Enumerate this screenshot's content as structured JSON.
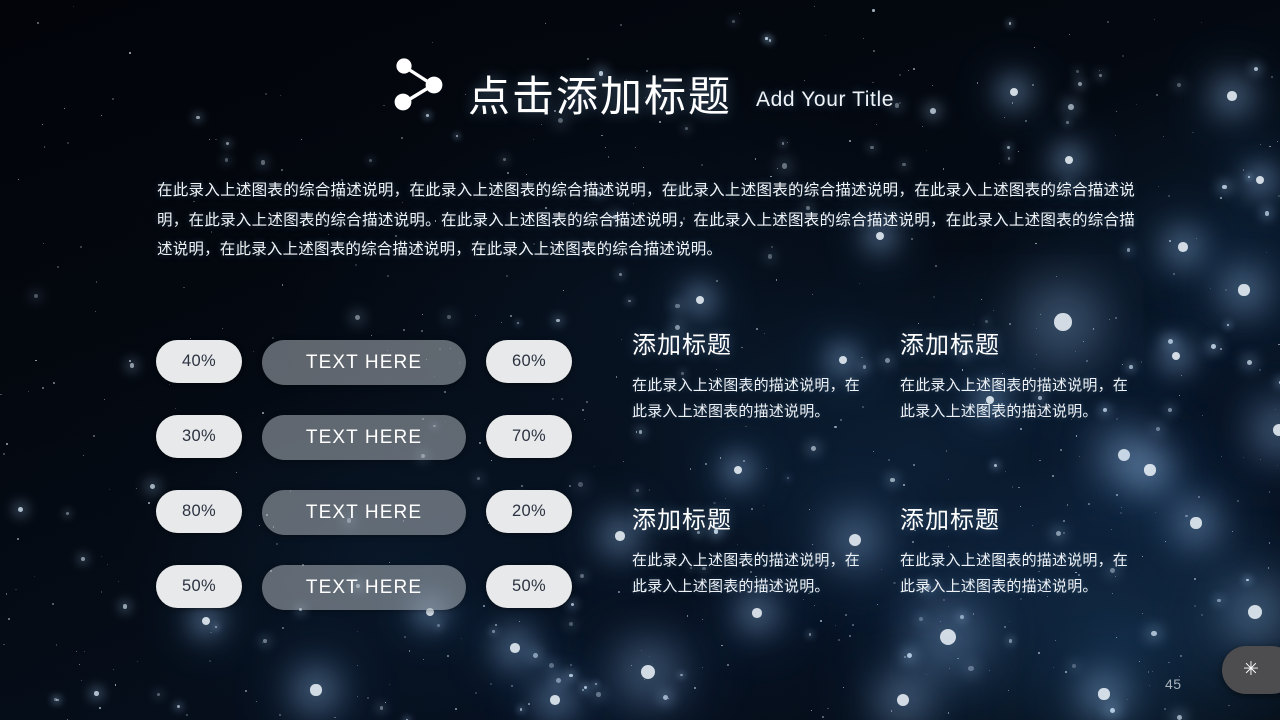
{
  "header": {
    "icon": "share-nodes-icon",
    "title_cn": "点击添加标题",
    "title_en": "Add Your Title"
  },
  "intro": {
    "text": "在此录入上述图表的综合描述说明，在此录入上述图表的综合描述说明，在此录入上述图表的综合描述说明，在此录入上述图表的综合描述说明，在此录入上述图表的综合描述说明。在此录入上述图表的综合描述说明，在此录入上述图表的综合描述说明，在此录入上述图表的综合描述说明，在此录入上述图表的综合描述说明，在此录入上述图表的综合描述说明。"
  },
  "rows": [
    {
      "left_value": "40%",
      "label": "TEXT HERE",
      "right_value": "60%"
    },
    {
      "left_value": "30%",
      "label": "TEXT HERE",
      "right_value": "70%"
    },
    {
      "left_value": "80%",
      "label": "TEXT HERE",
      "right_value": "20%"
    },
    {
      "left_value": "50%",
      "label": "TEXT HERE",
      "right_value": "50%"
    }
  ],
  "features": [
    {
      "title": "添加标题",
      "body": "在此录入上述图表的描述说明，在此录入上述图表的描述说明。"
    },
    {
      "title": "添加标题",
      "body": "在此录入上述图表的描述说明，在此录入上述图表的描述说明。"
    },
    {
      "title": "添加标题",
      "body": "在此录入上述图表的描述说明，在此录入上述图表的描述说明。"
    },
    {
      "title": "添加标题",
      "body": "在此录入上述图表的描述说明，在此录入上述图表的描述说明。"
    }
  ],
  "footer": {
    "page_number": "45",
    "corner_glyph": "✳",
    "corner_icon": "asterisk-icon"
  },
  "colors": {
    "background_dark": "#03070e",
    "background_glow": "#16375a",
    "pill_value_bg": "#e8e9ea",
    "pill_value_text": "#2c3342",
    "pill_label_bg": "#a8aeb6",
    "text_primary": "#ffffff",
    "page_number": "#a9b3bd",
    "corner_tab": "#4d4d4f"
  }
}
